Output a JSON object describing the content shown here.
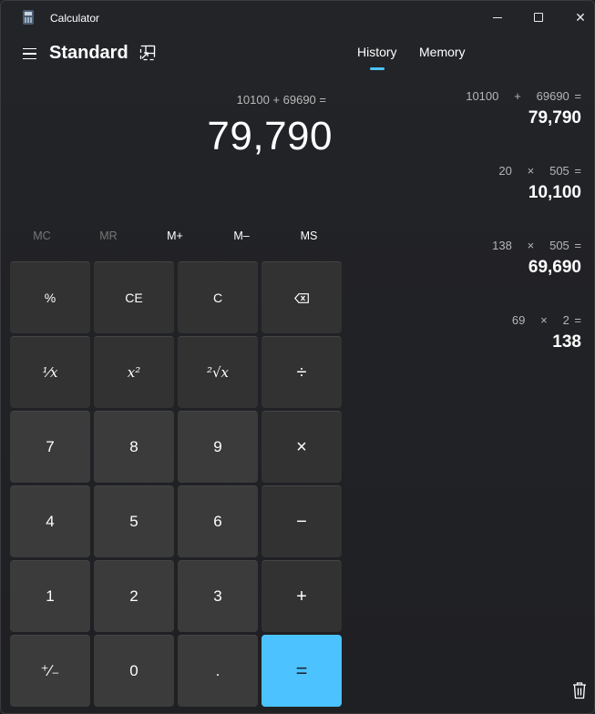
{
  "window": {
    "title": "Calculator",
    "minimize_label": "",
    "maximize_label": "",
    "close_label": "✕"
  },
  "header": {
    "mode": "Standard"
  },
  "tabs": [
    {
      "label": "History",
      "active": true
    },
    {
      "label": "Memory",
      "active": false
    }
  ],
  "display": {
    "expression": "10100 + 69690 =",
    "result": "79,790"
  },
  "memory_buttons": [
    {
      "label": "MC",
      "enabled": false
    },
    {
      "label": "MR",
      "enabled": false
    },
    {
      "label": "M+",
      "enabled": true
    },
    {
      "label": "M–",
      "enabled": true
    },
    {
      "label": "MS",
      "enabled": true
    }
  ],
  "keys": {
    "percent": "%",
    "ce": "CE",
    "clear": "C",
    "reciprocal": "⅟x",
    "square": "x²",
    "sqrt": "²√x",
    "divide": "÷",
    "seven": "7",
    "eight": "8",
    "nine": "9",
    "multiply": "×",
    "four": "4",
    "five": "5",
    "six": "6",
    "minus": "−",
    "one": "1",
    "two": "2",
    "three": "3",
    "plus": "+",
    "negate": "⁺∕₋",
    "zero": "0",
    "decimal": ".",
    "equals": "="
  },
  "history": [
    {
      "expression": "10100   +   69690 =",
      "result": "79,790"
    },
    {
      "expression": "20   ×   505 =",
      "result": "10,100"
    },
    {
      "expression": "138   ×   505 =",
      "result": "69,690"
    },
    {
      "expression": "69   ×   2 =",
      "result": "138"
    }
  ],
  "colors": {
    "accent": "#4cc2ff",
    "background": "#202124",
    "key": "#3b3b3b",
    "function_key": "#323232"
  },
  "icons": {
    "app": "calculator-icon",
    "menu": "hamburger-icon",
    "keep_on_top": "keep-on-top-icon",
    "backspace": "backspace-icon",
    "delete_history": "trash-icon"
  }
}
